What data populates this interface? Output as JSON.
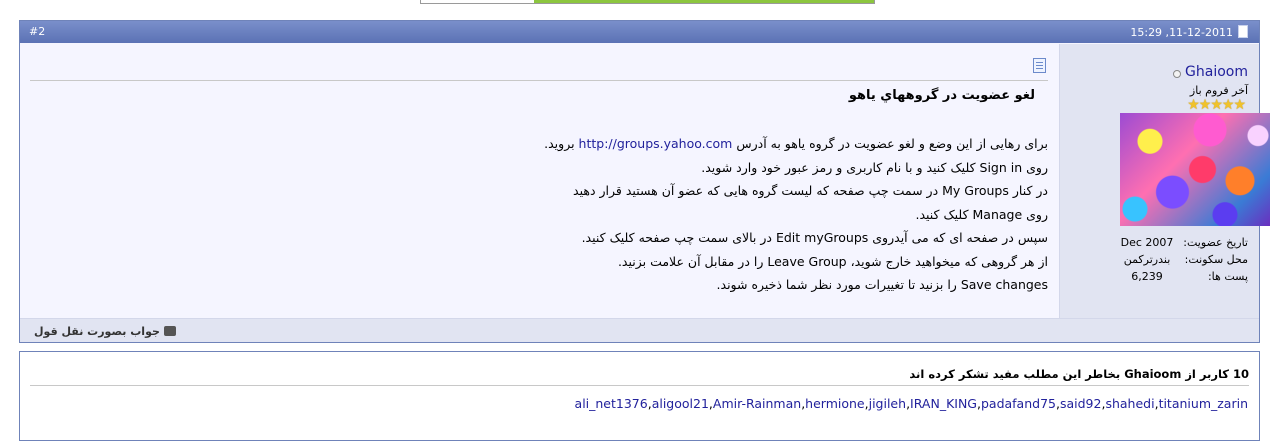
{
  "post": {
    "number": "#2",
    "date": "11-12-2011",
    "time": "15:29",
    "title": "لغو عضويت در گروههاي ياهو",
    "message_lines": [
      "برای رهایی از این وضع و لغو عضویت در گروه یاهو به آدرس http://groups.yahoo.com بروید.",
      "روی Sign in کلیک کنید و با نام کاربری و رمز عبور خود وارد شوید.",
      "در کنار My Groups در سمت چپ صفحه که لیست گروه هایی که عضو آن هستید قرار دهید",
      "روی Manage کلیک کنید.",
      "سپس در صفحه ای که می آیدروی Edit myGroups در بالای سمت چپ صفحه کلیک کنید.",
      "از هر گروهی که میخواهید خارج شوید، Leave Group را در مقابل آن علامت بزنید.",
      "Save changes را بزنید تا تغییرات مورد نظر شما ذخیره شوند."
    ],
    "quote_reply_label": "جواب بصورت نقل قول"
  },
  "user": {
    "name": "Ghaioom",
    "title": "آخر فروم باز",
    "stars": "★★★★★",
    "join_label": "تاريخ عضويت:",
    "join_value": "Dec 2007",
    "location_label": "محل سکونت:",
    "location_value": "بندرترکمن",
    "posts_label": "پست ها:",
    "posts_value": "6,239"
  },
  "thanks": {
    "title": "10 کاربر از Ghaioom بخاطر اين مطلب مفيد تشکر کرده اند",
    "users": [
      "ali_net1376",
      "aligool21",
      "Amir-Rainman",
      "hermione",
      "jigileh",
      "IRAN_KING",
      "padafand75",
      "said92",
      "shahedi",
      "titanium_zarin"
    ]
  },
  "colors": {
    "header_bg": "#5b72b5",
    "post_bg": "#f5f5ff",
    "sidebar_bg": "#e1e4f2",
    "link": "#22229c"
  }
}
